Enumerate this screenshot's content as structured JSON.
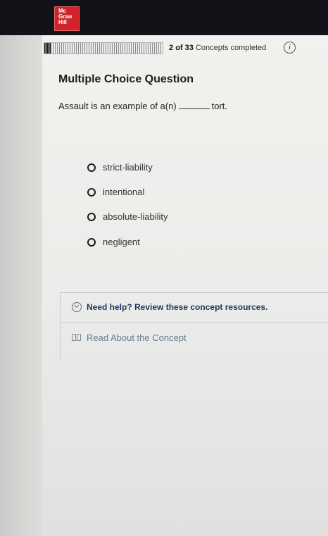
{
  "brand": {
    "logo_lines": [
      "Mc",
      "Graw",
      "Hill"
    ],
    "color": "#d2232a"
  },
  "progress": {
    "completed": "2",
    "total": "33",
    "of_text": "of",
    "label": "Concepts completed",
    "fraction": 0.06,
    "info_icon": "info-icon"
  },
  "question": {
    "heading": "Multiple Choice Question",
    "prompt_before": "Assault is an example of a(n)",
    "prompt_after": "tort.",
    "options": [
      {
        "label": "strict-liability"
      },
      {
        "label": "intentional"
      },
      {
        "label": "absolute-liability"
      },
      {
        "label": "negligent"
      }
    ]
  },
  "help": {
    "toggle_label": "Need help? Review these concept resources.",
    "toggle_icon": "chevron-down-icon",
    "resource_label": "Read About the Concept",
    "resource_icon": "book-icon",
    "accent": "#1e3a63"
  }
}
